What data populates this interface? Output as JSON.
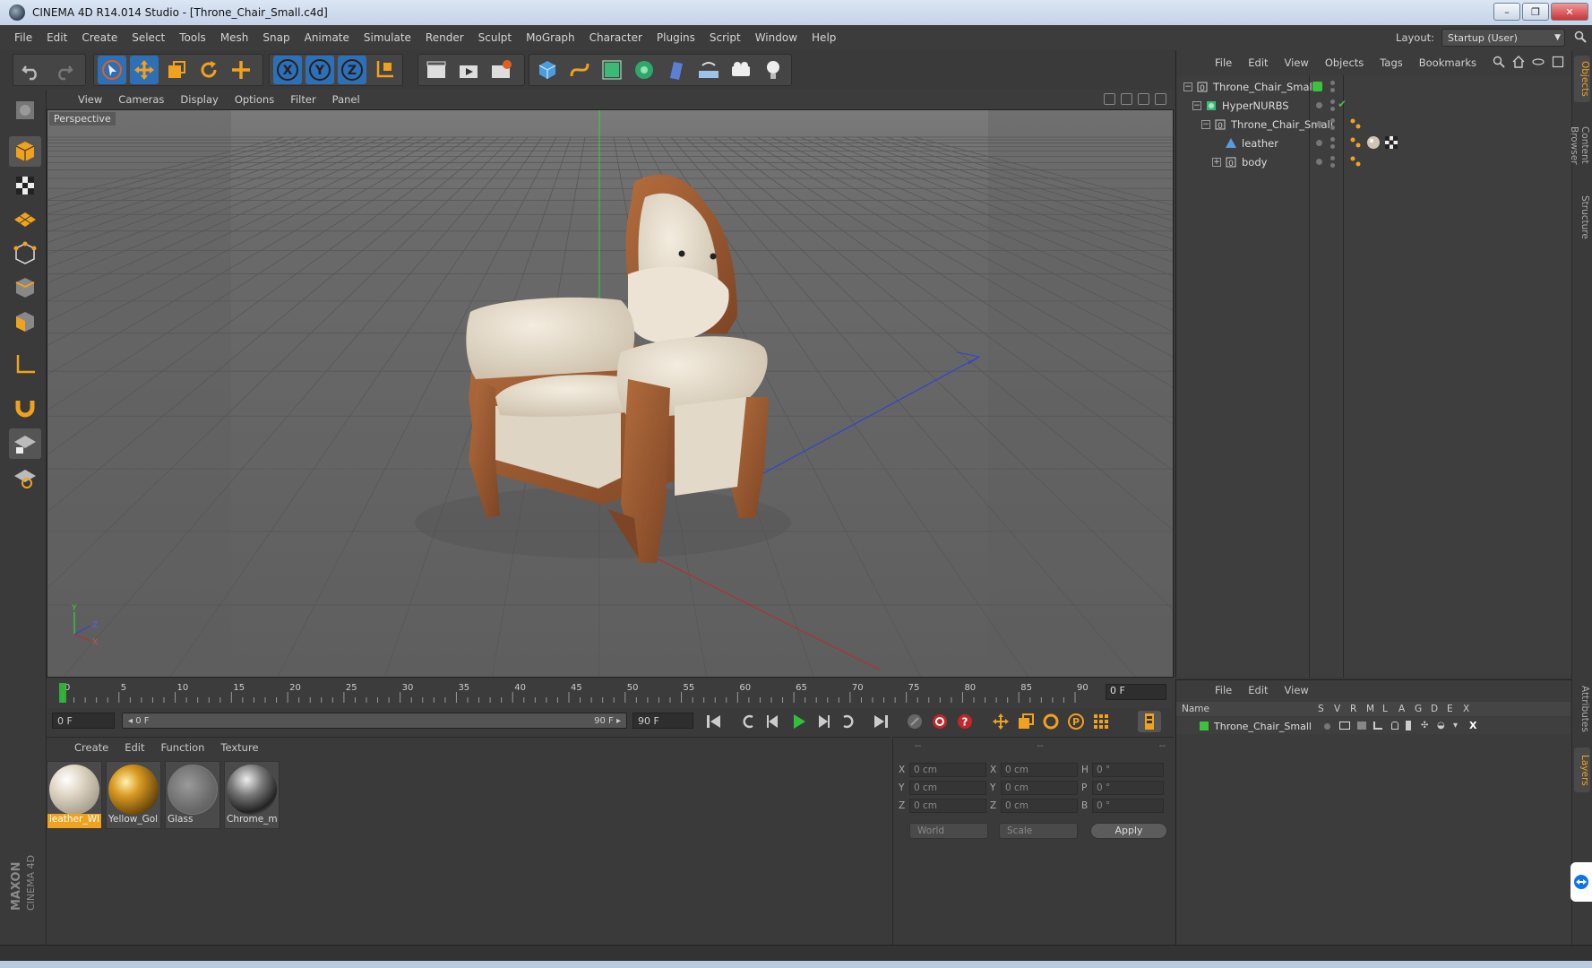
{
  "window": {
    "title": "CINEMA 4D R14.014 Studio - [Throne_Chair_Small.c4d]",
    "minimize": "–",
    "maximize": "❐",
    "close": "✕"
  },
  "menubar": {
    "items": [
      "File",
      "Edit",
      "Create",
      "Select",
      "Tools",
      "Mesh",
      "Snap",
      "Animate",
      "Simulate",
      "Render",
      "Sculpt",
      "MoGraph",
      "Character",
      "Plugins",
      "Script",
      "Window",
      "Help"
    ],
    "layout_label": "Layout:",
    "layout_value": "Startup (User)"
  },
  "toolbar": {
    "icons": [
      "undo-icon",
      "redo-icon",
      "live-selection-icon",
      "move-icon",
      "scale-icon",
      "rotate-icon",
      "add-object-icon",
      "x-axis-icon",
      "y-axis-icon",
      "z-axis-icon",
      "world-coordinates-icon",
      "render-view-icon",
      "render-picture-viewer-icon",
      "render-settings-icon",
      "cube-icon",
      "spline-icon",
      "nurbs-icon",
      "array-icon",
      "deformer-icon",
      "floor-icon",
      "camera-icon",
      "light-icon"
    ]
  },
  "viewport": {
    "menu": [
      "View",
      "Cameras",
      "Display",
      "Options",
      "Filter",
      "Panel"
    ],
    "label": "Perspective",
    "axis_y": "Y",
    "axis_z": "Z",
    "axis_x": "X"
  },
  "timeline": {
    "ticks": [
      "0",
      "5",
      "10",
      "15",
      "20",
      "25",
      "30",
      "35",
      "40",
      "45",
      "50",
      "55",
      "60",
      "65",
      "70",
      "75",
      "80",
      "85",
      "90"
    ],
    "current_frame": "0 F"
  },
  "transport": {
    "start_field": "0 F",
    "slider_left": "◂ 0 F",
    "slider_right": "90 F ▸",
    "end_field": "90 F"
  },
  "material_manager": {
    "menu": [
      "Create",
      "Edit",
      "Function",
      "Texture"
    ],
    "materials": [
      {
        "name": "leather_WI",
        "selected": true
      },
      {
        "name": "Yellow_Gol",
        "selected": false
      },
      {
        "name": "Glass",
        "selected": false
      },
      {
        "name": "Chrome_m",
        "selected": false
      }
    ]
  },
  "coordinates": {
    "headers": [
      "--",
      "--",
      "--"
    ],
    "rows": [
      {
        "l1": "X",
        "v1": "0 cm",
        "l2": "X",
        "v2": "0 cm",
        "l3": "H",
        "v3": "0 °"
      },
      {
        "l1": "Y",
        "v1": "0 cm",
        "l2": "Y",
        "v2": "0 cm",
        "l3": "P",
        "v3": "0 °"
      },
      {
        "l1": "Z",
        "v1": "0 cm",
        "l2": "Z",
        "v2": "0 cm",
        "l3": "B",
        "v3": "0 °"
      }
    ],
    "mode1": "World",
    "mode2": "Scale",
    "apply": "Apply"
  },
  "object_manager": {
    "menu": [
      "File",
      "Edit",
      "View",
      "Objects",
      "Tags",
      "Bookmarks"
    ],
    "objects": [
      {
        "name": "Throne_Chair_Small",
        "indent": 0
      },
      {
        "name": "HyperNURBS",
        "indent": 1
      },
      {
        "name": "Throne_Chair_Small",
        "indent": 2
      },
      {
        "name": "leather",
        "indent": 3
      },
      {
        "name": "body",
        "indent": 3
      }
    ]
  },
  "right_tabs": [
    "Objects",
    "Content Browser",
    "Structure",
    "Attributes",
    "Layers"
  ],
  "attribute_manager": {
    "menu": [
      "File",
      "Edit",
      "View"
    ],
    "columns": [
      "Name",
      "S",
      "V",
      "R",
      "M",
      "L",
      "A",
      "G",
      "D",
      "E",
      "X"
    ],
    "row_name": "Throne_Chair_Small"
  },
  "colors": {
    "accent": "#f0a21e",
    "active_blue": "#2e6fb5",
    "chair_wood": "#9a5a32",
    "chair_leather": "#e6dccb",
    "layer_green": "#3ec13e"
  }
}
